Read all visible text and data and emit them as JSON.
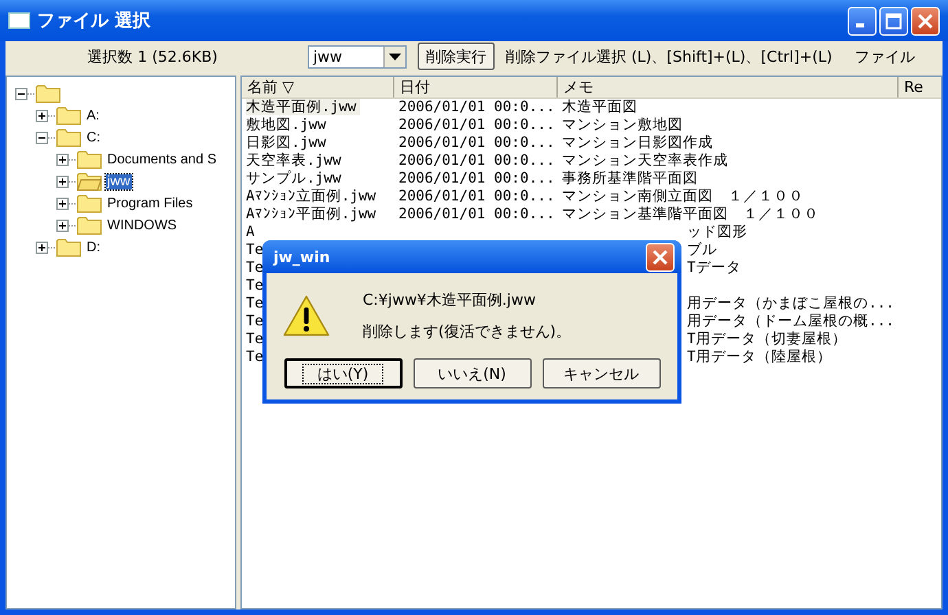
{
  "window": {
    "title": "ファイル 選択"
  },
  "toolbar": {
    "selection_info": "選択数 1 (52.6KB)",
    "folder_combo": {
      "value": "jww"
    },
    "delete_button": "削除実行",
    "hint": "削除ファイル選択 (L)、[Shift]+(L)、[Ctrl]+(L)",
    "cut_label": "ファイル"
  },
  "tree": {
    "expanded": true,
    "children": [
      {
        "label": "A:",
        "expanded": false,
        "selected": false
      },
      {
        "label": "C:",
        "expanded": true,
        "selected": false,
        "children": [
          {
            "label": "Documents and S",
            "expanded": false,
            "selected": false
          },
          {
            "label": "jww",
            "expanded": false,
            "selected": true
          },
          {
            "label": "Program Files",
            "expanded": false,
            "selected": false
          },
          {
            "label": "WINDOWS",
            "expanded": false,
            "selected": false
          }
        ]
      },
      {
        "label": "D:",
        "expanded": false,
        "selected": false
      }
    ]
  },
  "file_list": {
    "columns": [
      "名前 ▽",
      "日付",
      "メモ",
      "Re"
    ],
    "rows": [
      {
        "kind": "full",
        "name": "木造平面例.jww",
        "date": "2006/01/01 00:0...",
        "memo": "木造平面図",
        "selected": true
      },
      {
        "kind": "full",
        "name": "敷地図.jww",
        "date": "2006/01/01 00:0...",
        "memo": "マンション敷地図",
        "selected": false
      },
      {
        "kind": "full",
        "name": "日影図.jww",
        "date": "2006/01/01 00:0...",
        "memo": "マンション日影図作成",
        "selected": false
      },
      {
        "kind": "full",
        "name": "天空率表.jww",
        "date": "2006/01/01 00:0...",
        "memo": "マンション天空率表作成",
        "selected": false
      },
      {
        "kind": "full",
        "name": "サンプル.jww",
        "date": "2006/01/01 00:0...",
        "memo": "事務所基準階平面図",
        "selected": false
      },
      {
        "kind": "full",
        "name": "Aﾏﾝｼｮﾝ立面例.jww",
        "date": "2006/01/01 00:0...",
        "memo": "マンション南側立面図　１／１００",
        "selected": false
      },
      {
        "kind": "full",
        "name": "Aﾏﾝｼｮﾝ平面例.jww",
        "date": "2006/01/01 00:0...",
        "memo": "マンション基準階平面図　１／１００",
        "selected": false
      },
      {
        "kind": "covered",
        "name": "A",
        "memo": "ッド図形",
        "selected": false
      },
      {
        "kind": "covered",
        "name": "Te",
        "memo": "ブル",
        "selected": false
      },
      {
        "kind": "covered",
        "name": "Te",
        "memo": "Tデータ",
        "selected": false
      },
      {
        "kind": "covered",
        "name": "Te",
        "selected": false
      },
      {
        "kind": "covered",
        "name": "Te",
        "memo": "用データ（かまぼこ屋根の...",
        "selected": false
      },
      {
        "kind": "covered",
        "name": "Te",
        "memo": "用データ（ドーム屋根の概...",
        "selected": false
      },
      {
        "kind": "covered",
        "name": "Te",
        "memo": "T用データ（切妻屋根）",
        "selected": false
      },
      {
        "kind": "covered",
        "name": "Te",
        "memo": "T用データ（陸屋根）",
        "selected": false
      }
    ]
  },
  "dialog": {
    "title": "jw_win",
    "lines": [
      "C:¥jww¥木造平面例.jww",
      "削除します(復活できません)。"
    ],
    "buttons": [
      {
        "label": "はい(Y)",
        "default": true
      },
      {
        "label": "いいえ(N)",
        "default": false
      },
      {
        "label": "キャンセル",
        "default": false
      }
    ]
  }
}
